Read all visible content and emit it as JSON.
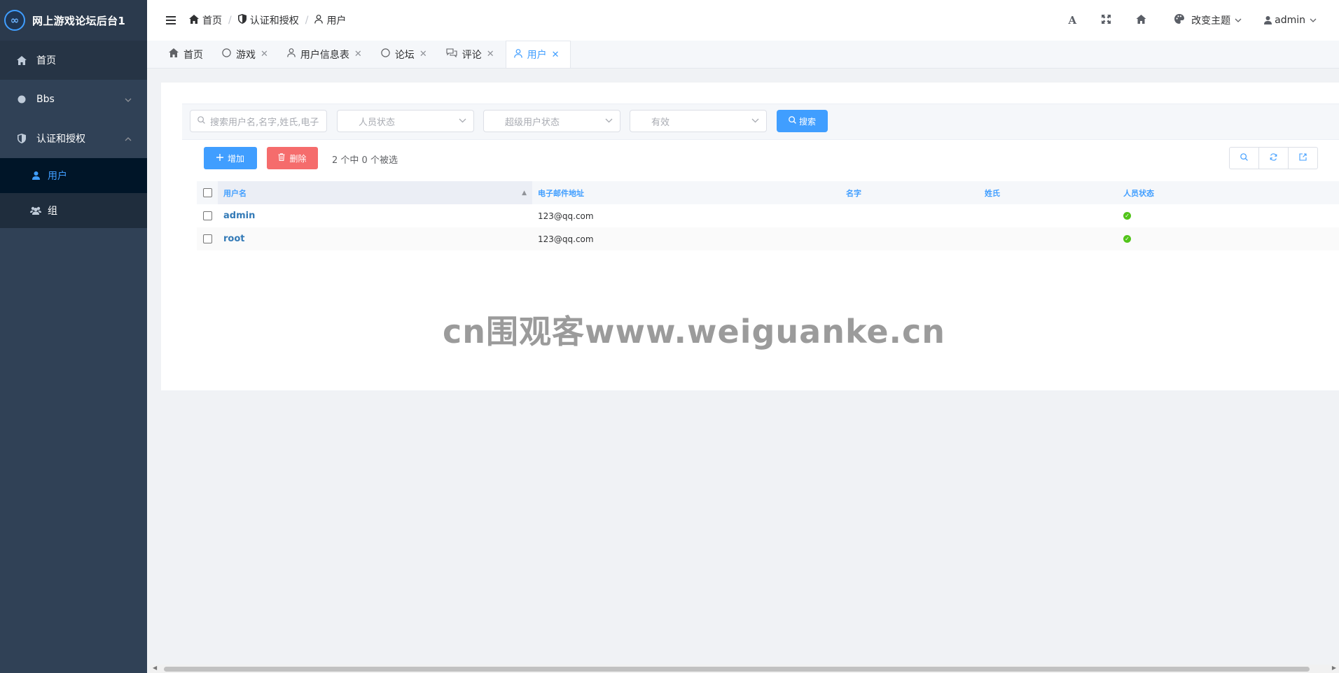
{
  "app": {
    "title": "网上游戏论坛后台1",
    "logo_glyph": "∞"
  },
  "sidebar": {
    "items": [
      {
        "label": "首页",
        "icon": "home-icon"
      },
      {
        "label": "Bbs",
        "icon": "circle-icon"
      },
      {
        "label": "认证和授权",
        "icon": "shield-icon"
      }
    ],
    "subitems": [
      {
        "label": "用户",
        "icon": "user-icon"
      },
      {
        "label": "组",
        "icon": "users-icon"
      }
    ]
  },
  "header": {
    "breadcrumb": [
      "首页",
      "认证和授权",
      "用户"
    ],
    "breadcrumb_separator": "/",
    "theme_label": "改变主题",
    "user_label": "admin"
  },
  "tabs": [
    {
      "label": "首页",
      "icon": "home-icon",
      "closable": false
    },
    {
      "label": "游戏",
      "icon": "circle-icon",
      "closable": true
    },
    {
      "label": "用户信息表",
      "icon": "user-icon",
      "closable": true
    },
    {
      "label": "论坛",
      "icon": "circle-icon",
      "closable": true
    },
    {
      "label": "评论",
      "icon": "comments-icon",
      "closable": true
    },
    {
      "label": "用户",
      "icon": "user-icon",
      "closable": true,
      "active": true
    }
  ],
  "filters": {
    "search_placeholder": "搜索用户名,名字,姓氏,电子",
    "staff_status": "人员状态",
    "superuser_status": "超级用户状态",
    "active": "有效",
    "search_button": "搜索"
  },
  "actions": {
    "add": "增加",
    "delete": "删除",
    "selection_text": "2 个中 0 个被选"
  },
  "table": {
    "columns": [
      "用户名",
      "电子邮件地址",
      "名字",
      "姓氏",
      "人员状态"
    ],
    "rows": [
      {
        "username": "admin",
        "email": "123@qq.com",
        "first_name": "",
        "last_name": "",
        "staff": true
      },
      {
        "username": "root",
        "email": "123@qq.com",
        "first_name": "",
        "last_name": "",
        "staff": true
      }
    ]
  },
  "watermark": "cn围观客www.weiguanke.cn",
  "colors": {
    "primary": "#409eff",
    "danger": "#f56c6c",
    "sidebar_bg": "#304156",
    "success": "#52c41a"
  }
}
